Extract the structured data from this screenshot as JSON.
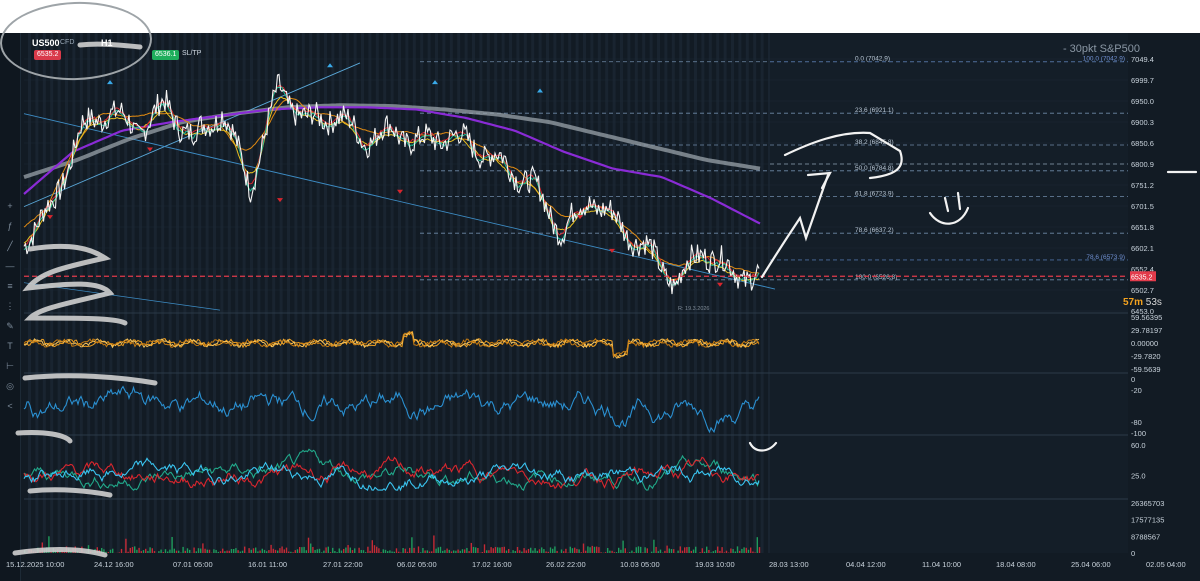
{
  "toolbar": {
    "symbol": "US500",
    "symbol_tag": "CFD",
    "timeframe": "H1",
    "sell_price": "6535.2",
    "buy_price": "6536.1",
    "sltp_label": "SL/TP"
  },
  "watermark": "- 30pkt S&P500",
  "timer": {
    "minutes": "57m",
    "seconds": "53s"
  },
  "marker_label": "R: 19.3.2026",
  "colors": {
    "background": "#121b24",
    "fib_line": "#6f8aa8",
    "price_line": "#e23b4b",
    "ema_purple": "#8a2bd6",
    "ema_grey": "#9aa3aa",
    "macd_orange": "#f0a020",
    "rsi_blue": "#2a8fd0",
    "dmi_red": "#d8262e",
    "dmi_green": "#21a88a",
    "dmi_cyan": "#3ac4f0",
    "volume_red": "#c42a36",
    "volume_green": "#1e9b5c",
    "drawing": "#f2f2f2"
  },
  "chart_data": [
    {
      "type": "line",
      "panel": "price",
      "y_ticks": [
        "7049.4",
        "6999.7",
        "6950.0",
        "6900.3",
        "6850.6",
        "6800.9",
        "6751.2",
        "6701.5",
        "6651.8",
        "6602.1",
        "6552.4",
        "6502.7",
        "6453.0"
      ],
      "ylim": [
        6453.0,
        7049.4
      ],
      "x_ticks": [
        "15.12.2025 10:00",
        "24.12 16:00",
        "07.01 05:00",
        "16.01 11:00",
        "27.01 22:00",
        "06.02 05:00",
        "17.02 16:00",
        "26.02 22:00",
        "10.03 05:00",
        "19.03 10:00",
        "28.03 13:00",
        "04.04 12:00",
        "11.04 10:00",
        "18.04 08:00",
        "25.04 06:00",
        "02.05 04:00"
      ],
      "current_price": "6535.2",
      "current_price_value": 6535.2,
      "price_key": [
        6620,
        6700,
        6880,
        6930,
        6880,
        6940,
        6860,
        6930,
        6750,
        6980,
        6900,
        6920,
        6860,
        6880,
        6850,
        6870,
        6840,
        6800,
        6750,
        6640,
        6720,
        6660,
        6600,
        6520,
        6600,
        6545,
        6535
      ],
      "ema_purple_key": [
        6730,
        6830,
        6880,
        6900,
        6915,
        6930,
        6935,
        6935,
        6930,
        6910,
        6880,
        6830,
        6790,
        6770,
        6720,
        6660
      ],
      "ema_grey_key": [
        6770,
        6810,
        6860,
        6900,
        6920,
        6935,
        6940,
        6938,
        6930,
        6918,
        6900,
        6870,
        6840,
        6810,
        6790
      ],
      "fib_levels": [
        {
          "label": "0.0 (7042.9)",
          "value": 7042.9
        },
        {
          "label": "23.6 (6921.1)",
          "value": 6921.1
        },
        {
          "label": "38.2 (6845.8)",
          "value": 6845.8
        },
        {
          "label": "50.0 (6784.8)",
          "value": 6784.8
        },
        {
          "label": "61.8 (6723.9)",
          "value": 6723.9
        },
        {
          "label": "78.6 (6637.2)",
          "value": 6637.2
        },
        {
          "label": "100.0 (6526.8)",
          "value": 6526.8
        }
      ],
      "fib_levels_right": [
        {
          "label": "100.0 (7042.9)",
          "value": 7042.9
        },
        {
          "label": "78.6 (6573.9)",
          "value": 6573.9
        }
      ]
    },
    {
      "type": "line",
      "panel": "macd",
      "y_ticks": [
        "59.56395",
        "29.78197",
        "0.00000",
        "-29.7820",
        "-59.5639"
      ],
      "ylim": [
        -59.5639,
        59.56395
      ]
    },
    {
      "type": "line",
      "panel": "rsi",
      "y_ticks": [
        "0",
        "-20",
        "-80",
        "-100"
      ],
      "ylim": [
        -100,
        0
      ]
    },
    {
      "type": "line",
      "panel": "dmi",
      "y_ticks": [
        "60.0",
        "25.0"
      ],
      "ylim": [
        0,
        60
      ]
    },
    {
      "type": "bar",
      "panel": "volume",
      "y_ticks": [
        "26365703",
        "17577135",
        "8788567",
        "0"
      ],
      "ylim": [
        0,
        26365703
      ]
    }
  ]
}
